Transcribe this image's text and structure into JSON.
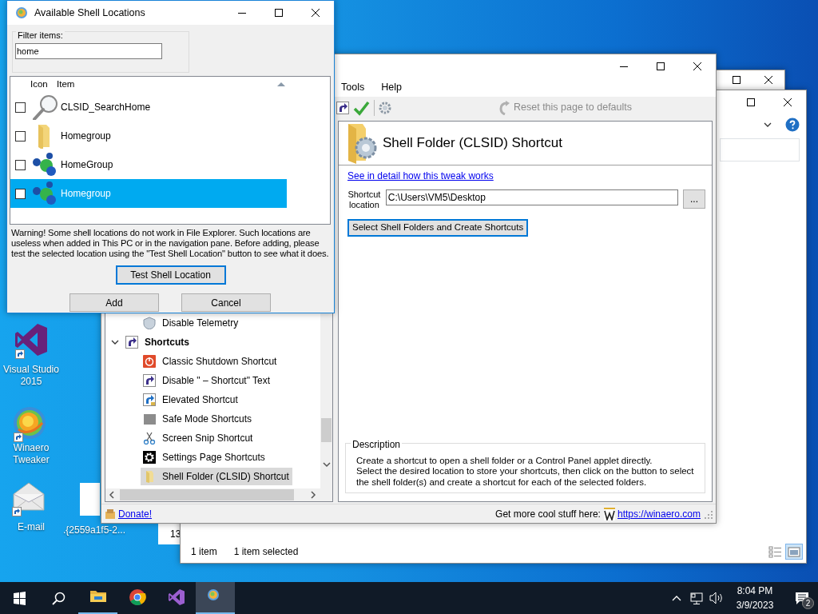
{
  "desktop": {
    "icons": [
      {
        "label": "Visual Studio 2015"
      },
      {
        "label": "Winaero Tweaker"
      },
      {
        "label": "E-mail"
      },
      {
        "label": ".{2559a1f5-2..."
      }
    ]
  },
  "explorer_window": {
    "status": [
      "1 item",
      "1 item selected"
    ],
    "views": [
      {
        "selected": false
      },
      {
        "selected": true
      }
    ]
  },
  "small_window": {
    "text": "13"
  },
  "main_window": {
    "menu": [
      "Tools",
      "Help"
    ],
    "reset_button": "Reset this page to defaults",
    "tree": [
      {
        "label": "Disable Telemetry",
        "kind": "tweak",
        "selected": false
      },
      {
        "label": "Shortcuts",
        "kind": "category",
        "expanded": true,
        "selected": false,
        "children": [
          {
            "label": "Classic Shutdown Shortcut",
            "selected": false
          },
          {
            "label": "Disable \" – Shortcut\" Text",
            "selected": false
          },
          {
            "label": "Elevated Shortcut",
            "selected": false
          },
          {
            "label": "Safe Mode Shortcuts",
            "selected": false
          },
          {
            "label": "Screen Snip Shortcut",
            "selected": false
          },
          {
            "label": "Settings Page Shortcuts",
            "selected": false
          },
          {
            "label": "Shell Folder (CLSID) Shortcut",
            "selected": true
          }
        ]
      }
    ],
    "page": {
      "title": "Shell Folder (CLSID) Shortcut",
      "link": "See in detail how this tweak works",
      "location_label": "Shortcut location",
      "location_value": "C:\\Users\\VM5\\Desktop",
      "browse_button": "...",
      "action_button": "Select Shell Folders and Create Shortcuts",
      "description_title": "Description",
      "description": [
        "Create a shortcut to open a shell folder or a Control Panel applet directly.",
        "Select the desired location to store your shortcuts, then click on the button to select the shell folder(s) and create a shortcut for each of the selected folders."
      ]
    },
    "status": {
      "donate": "Donate!",
      "promo": "Get more cool stuff here:",
      "url": "https://winaero.com"
    }
  },
  "dialog": {
    "title": "Available Shell Locations",
    "filter_label": "Filter items:",
    "filter_value": "home",
    "columns": [
      "Icon",
      "Item"
    ],
    "rows": [
      {
        "label": "CLSID_SearchHome",
        "checked": false,
        "selected": false
      },
      {
        "label": "Homegroup",
        "checked": false,
        "selected": false
      },
      {
        "label": "HomeGroup",
        "checked": false,
        "selected": false
      },
      {
        "label": "Homegroup",
        "checked": false,
        "selected": true
      }
    ],
    "warning": "Warning! Some shell locations do not work in File Explorer. Such locations are useless when added in This PC or in the navigation pane. Before adding, please test the selected location using the \"Test Shell Location\" button to see what it does.",
    "test_button": "Test Shell Location",
    "buttons": [
      "Add",
      "Cancel"
    ]
  },
  "taskbar": {
    "apps": [
      {
        "running": true,
        "selected": false
      },
      {
        "running": false,
        "selected": false
      },
      {
        "running": false,
        "selected": false
      },
      {
        "running": true,
        "selected": true
      }
    ],
    "time": "8:04 PM",
    "date": "3/9/2023",
    "notifications": "2"
  }
}
